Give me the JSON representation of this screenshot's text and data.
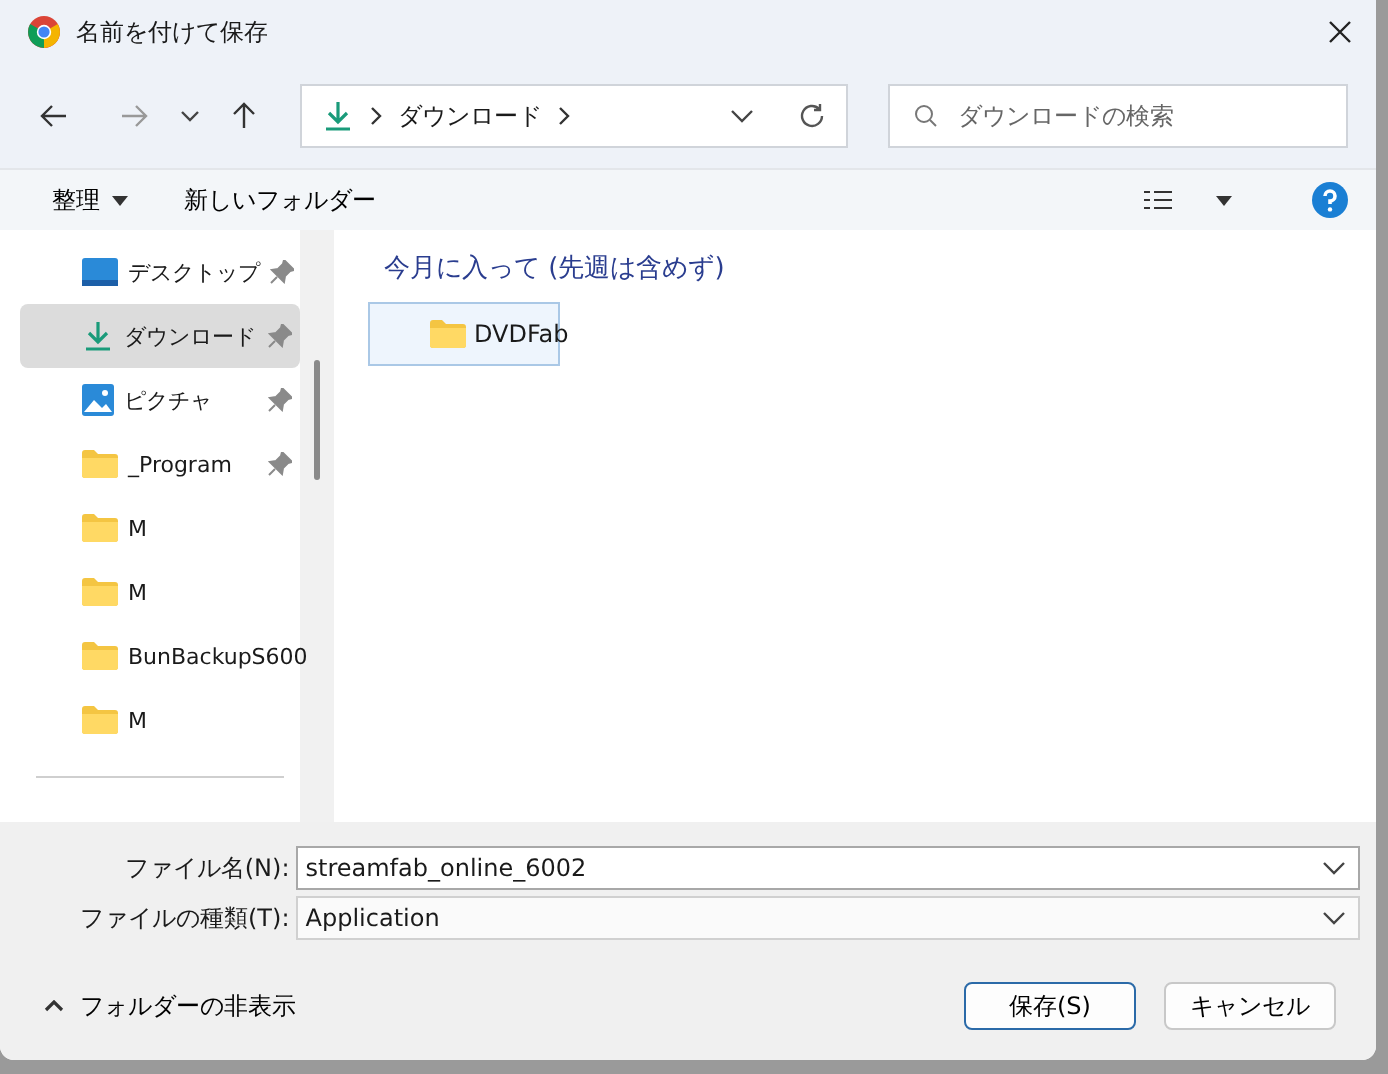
{
  "window": {
    "title": "名前を付けて保存"
  },
  "address": {
    "path": "ダウンロード",
    "search_placeholder": "ダウンロードの検索"
  },
  "toolbar": {
    "organize": "整理",
    "new_folder": "新しいフォルダー"
  },
  "sidebar": {
    "items": [
      {
        "label": "デスクトップ",
        "kind": "desktop",
        "pinned": true,
        "selected": false
      },
      {
        "label": "ダウンロード",
        "kind": "download",
        "pinned": true,
        "selected": true
      },
      {
        "label": "ピクチャ",
        "kind": "pictures",
        "pinned": true,
        "selected": false
      },
      {
        "label": "_Program",
        "kind": "folder",
        "pinned": true,
        "selected": false
      },
      {
        "label": "M",
        "kind": "folder",
        "pinned": false,
        "selected": false
      },
      {
        "label": "M",
        "kind": "folder",
        "pinned": false,
        "selected": false
      },
      {
        "label": "BunBackupS600",
        "kind": "folder",
        "pinned": false,
        "selected": false
      },
      {
        "label": "M",
        "kind": "folder",
        "pinned": false,
        "selected": false
      }
    ]
  },
  "content": {
    "group_heading": "今月に入って (先週は含めず)",
    "items": [
      {
        "label": "DVDFab",
        "selected": true
      }
    ]
  },
  "form": {
    "file_name_label": "ファイル名(N):",
    "file_name": "streamfab_online_6002",
    "file_type_label": "ファイルの種類(T):",
    "file_type": "Application"
  },
  "footer": {
    "hide_folders": "フォルダーの非表示",
    "save": "保存(S)",
    "cancel": "キャンセル"
  }
}
